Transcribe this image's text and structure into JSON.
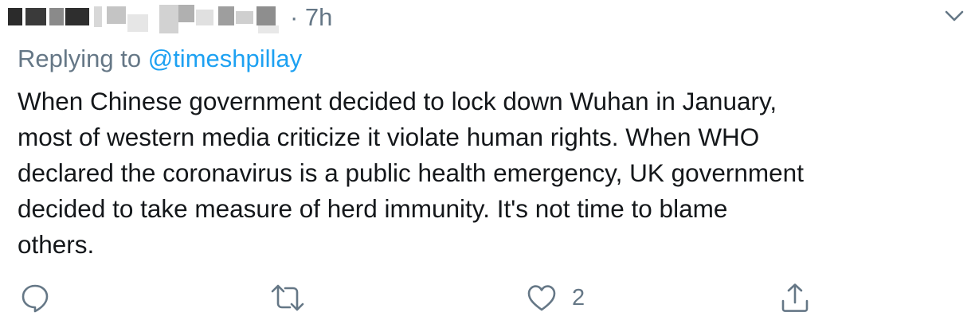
{
  "tweet": {
    "time": "· 7h",
    "replying_prefix": "Replying to ",
    "replying_handle": "@timeshpillay",
    "body_lines": [
      "When Chinese government decided to lock down Wuhan in January,",
      "most of western media criticize it violate human rights. When WHO",
      "declared the coronavirus is a public health emergency, UK government",
      "decided to take measure of herd immunity. It's not time to blame",
      "others."
    ],
    "like_count": "2"
  },
  "colors": {
    "text": "#14171a",
    "secondary": "#657786",
    "link": "#1da1f2"
  },
  "icons": {
    "more": "chevron-down-icon",
    "reply": "reply-icon",
    "retweet": "retweet-icon",
    "like": "heart-icon",
    "share": "share-icon"
  }
}
